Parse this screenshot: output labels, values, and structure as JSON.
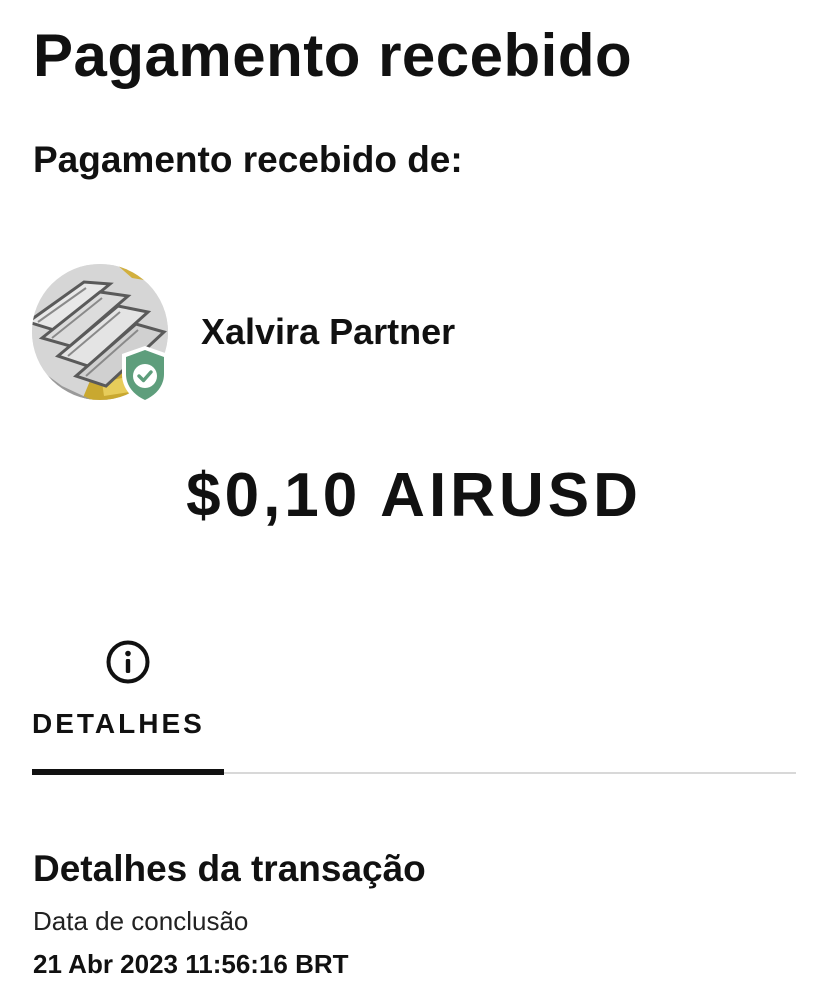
{
  "header": {
    "title": "Pagamento recebido",
    "subtitle": "Pagamento recebido de:"
  },
  "sender": {
    "name": "Xalvira Partner",
    "avatar_icon": "silver-gold-bars-avatar",
    "badge_icon": "verified-shield-icon",
    "badge_color": "#5e9e7c"
  },
  "payment": {
    "amount": "$0,10 AIRUSD"
  },
  "tabs": [
    {
      "label": "DETALHES",
      "icon": "info-icon",
      "active": true
    }
  ],
  "details": {
    "section_title": "Detalhes da transação",
    "completion_label": "Data de conclusão",
    "completion_value": "21 Abr 2023 11:56:16 BRT"
  }
}
